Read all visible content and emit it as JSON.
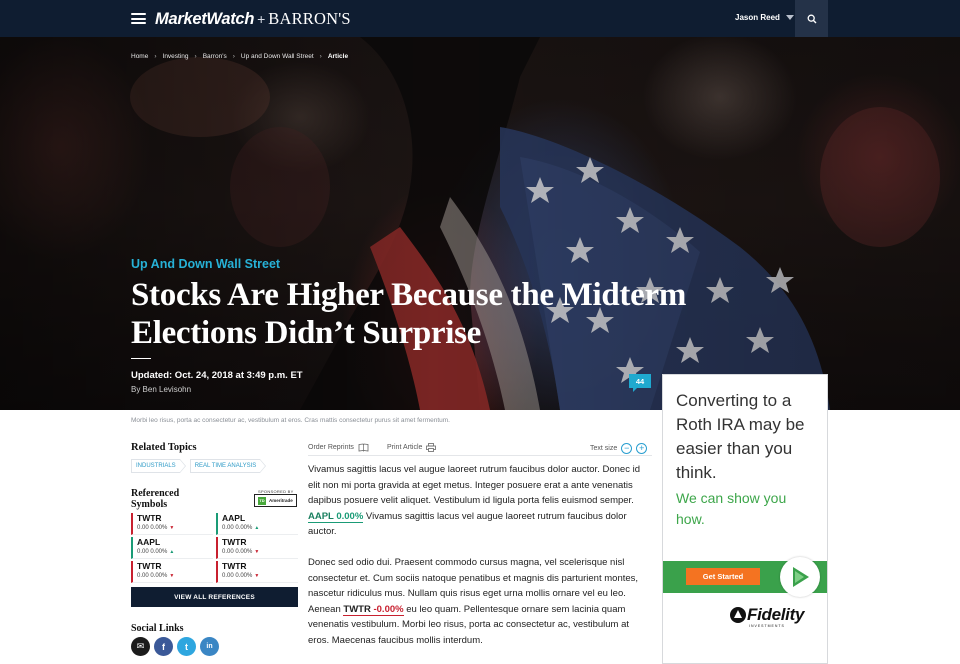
{
  "topbar": {
    "logo_primary": "MarketWatch",
    "logo_plus": "+",
    "logo_secondary": "BARRON'S",
    "user_name": "Jason Reed",
    "icons": [
      "menu-icon",
      "chevron-down-icon",
      "search-icon"
    ]
  },
  "breadcrumb": [
    "Home",
    "Investing",
    "Barron's",
    "Up and Down Wall Street",
    "Article"
  ],
  "hero": {
    "kicker": "Up And Down Wall Street",
    "headline": "Stocks Are Higher Because the Midterm Elections Didn’t Surprise",
    "updated": "Updated: Oct. 24, 2018 at 3:49 p.m. ET",
    "byline": "By Ben Levisohn",
    "comment_count": "44"
  },
  "caption": "Morbi leo risus, porta ac consectetur ac, vestibulum at eros. Cras mattis consectetur purus sit amet fermentum.",
  "related": {
    "title": "Related Topics",
    "topics": [
      "INDUSTRIALS",
      "REAL TIME ANALYSIS"
    ]
  },
  "referenced": {
    "title": "Referenced Symbols",
    "sponsored_by": "SPONSORED BY",
    "sponsor": "Ameritrade",
    "sponsor_mark": "TD",
    "symbols": [
      {
        "ticker": "TWTR",
        "change": "0.00 0.00%",
        "dir": "down"
      },
      {
        "ticker": "AAPL",
        "change": "0.00 0.00%",
        "dir": "up"
      },
      {
        "ticker": "AAPL",
        "change": "0.00 0.00%",
        "dir": "up"
      },
      {
        "ticker": "TWTR",
        "change": "0.00 0.00%",
        "dir": "down"
      },
      {
        "ticker": "TWTR",
        "change": "0.00 0.00%",
        "dir": "down"
      },
      {
        "ticker": "TWTR",
        "change": "0.00 0.00%",
        "dir": "down"
      }
    ],
    "view_all": "VIEW ALL REFERENCES"
  },
  "social": {
    "title": "Social Links",
    "items": [
      {
        "icon": "email-icon",
        "color": "#1b1b1b",
        "glyph": "✉"
      },
      {
        "icon": "facebook-icon",
        "color": "#3b5998",
        "glyph": "f"
      },
      {
        "icon": "twitter-icon",
        "color": "#2ea6df",
        "glyph": "t"
      },
      {
        "icon": "linkedin-icon",
        "color": "#3a86c4",
        "glyph": "in"
      }
    ]
  },
  "tools": {
    "order_reprints": "Order Reprints",
    "print_article": "Print Article",
    "text_size": "Text size",
    "decrease": "−",
    "increase": "+"
  },
  "article": {
    "p1_a": "Vivamus sagittis lacus vel augue laoreet rutrum faucibus dolor auctor. Donec id elit non mi porta gravida at eget metus. Integer posuere erat a ante venenatis dapibus posuere velit aliquet. Vestibulum id ligula porta felis euismod semper.",
    "p1_ticker": "AAPL",
    "p1_pct": "0.00%",
    "p1_b": "Vivamus sagittis lacus vel augue laoreet rutrum faucibus dolor auctor.",
    "p2_a": "Donec sed odio dui. Praesent commodo cursus magna, vel scelerisque nisl consectetur et. Cum sociis natoque penatibus et magnis dis parturient montes, nascetur ridiculus mus. Nullam quis risus eget urna mollis ornare vel eu leo. Aenean",
    "p2_ticker": "TWTR",
    "p2_pct": "-0.00%",
    "p2_b": "eu leo quam. Pellentesque ornare sem lacinia quam venenatis vestibulum. Morbi leo risus, porta ac consectetur ac, vestibulum at eros. Maecenas faucibus mollis interdum."
  },
  "ad": {
    "headline": "Converting to a Roth IRA may be easier than you think.",
    "subline": "We can show you how.",
    "button": "Get Started",
    "brand": "Fidelity",
    "brand_tag": "INVESTMENTS",
    "colors": {
      "green": "#3aa14b",
      "orange": "#f47321"
    }
  },
  "colors": {
    "nav_bg": "#0f1d31",
    "accent": "#27b1d6",
    "up": "#1a9b76",
    "down": "#c8202f"
  }
}
